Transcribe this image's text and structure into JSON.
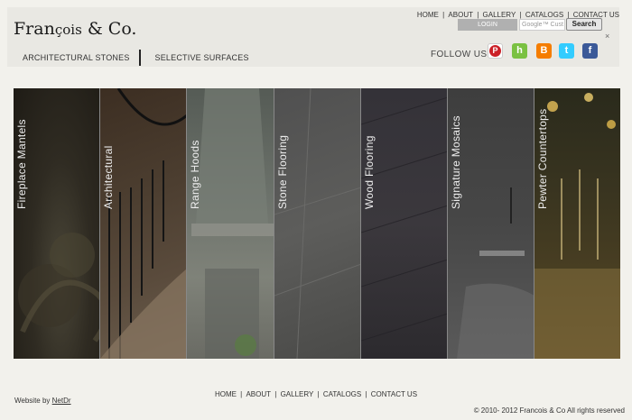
{
  "brand": {
    "logo_text_1": "Fran",
    "logo_text_2": "çois",
    "logo_amp": " & ",
    "logo_co": "Co."
  },
  "top_links": [
    "HOME",
    "ABOUT",
    "GALLERY",
    "CATALOGS",
    "CONTACT US"
  ],
  "login": {
    "label": "LOGIN"
  },
  "search": {
    "placeholder": "Google™ Cust",
    "button_label": "Search"
  },
  "close_label": "×",
  "follow_label": "FOLLOW US:",
  "social": [
    {
      "name": "pinterest-icon",
      "glyph": "P",
      "color": "#cb2027"
    },
    {
      "name": "houzz-icon",
      "glyph": "h",
      "color": "#7ac142"
    },
    {
      "name": "blogger-icon",
      "glyph": "B",
      "color": "#f57d00"
    },
    {
      "name": "twitter-icon",
      "glyph": "t",
      "color": "#33ccff"
    },
    {
      "name": "facebook-icon",
      "glyph": "f",
      "color": "#3b5998"
    }
  ],
  "main_nav": [
    "ARCHITECTURAL STONES",
    "SELECTIVE SURFACES"
  ],
  "panels": [
    "Fireplace Mantels",
    "Architectural",
    "Range Hoods",
    "Stone Flooring",
    "Wood Flooring",
    "Signature Mosaics",
    "Pewter Countertops"
  ],
  "footer_links": [
    "HOME",
    "ABOUT",
    "GALLERY",
    "CATALOGS",
    "CONTACT US"
  ],
  "website_by": {
    "prefix": "Website by ",
    "link": "NetDr"
  },
  "copyright": "© 2010- 2012 Francois & Co All rights reserved"
}
